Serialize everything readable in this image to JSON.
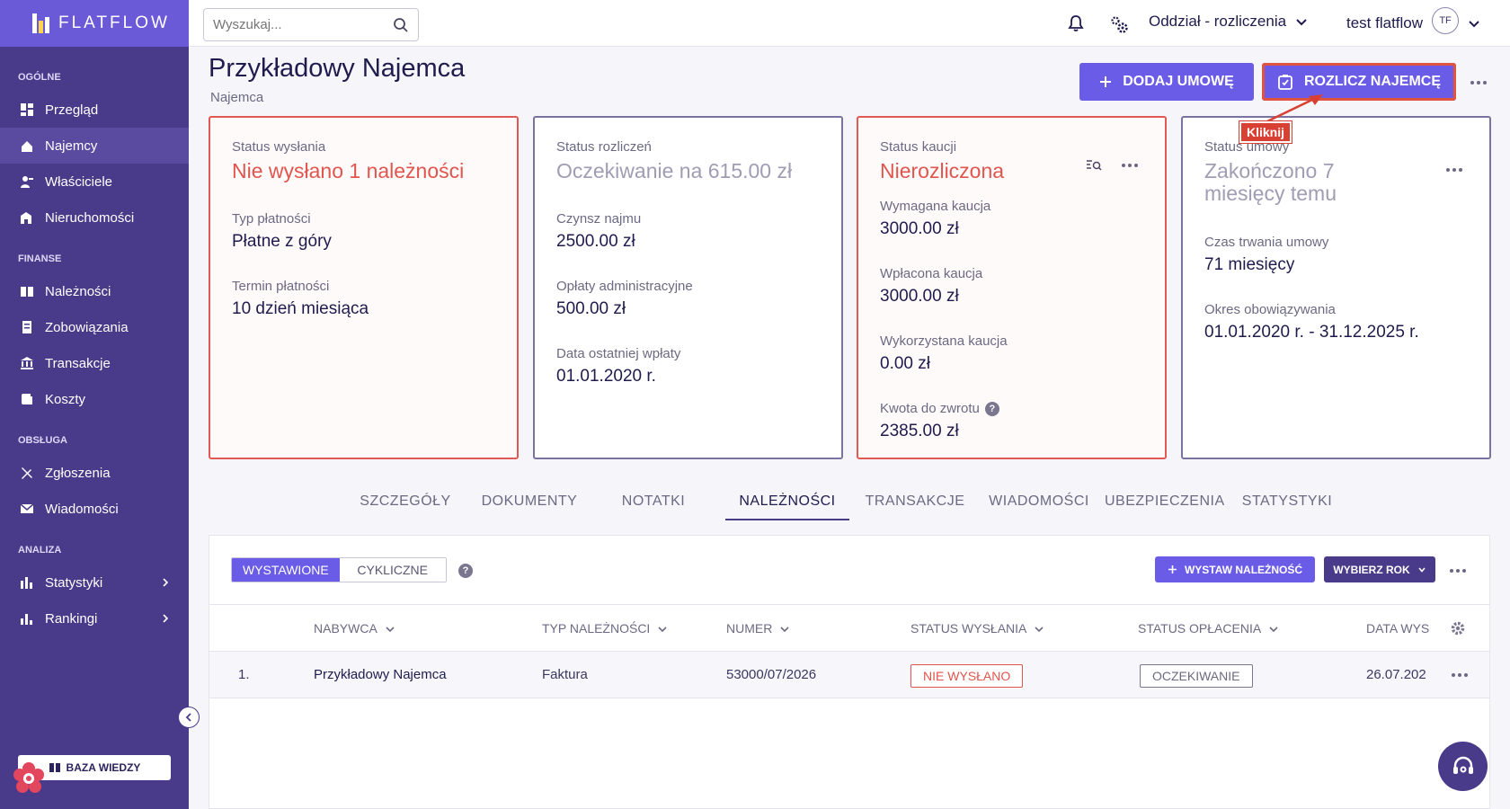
{
  "app": {
    "brand": "FLATFLOW"
  },
  "sidebar": {
    "sections": [
      "OGÓLNE",
      "FINANSE",
      "OBSŁUGA",
      "ANALIZA"
    ],
    "items": [
      {
        "label": "Przegląd"
      },
      {
        "label": "Najemcy",
        "active": true
      },
      {
        "label": "Właściciele"
      },
      {
        "label": "Nieruchomości"
      },
      {
        "label": "Należności"
      },
      {
        "label": "Zobowiązania"
      },
      {
        "label": "Transakcje"
      },
      {
        "label": "Koszty"
      },
      {
        "label": "Zgłoszenia"
      },
      {
        "label": "Wiadomości"
      },
      {
        "label": "Statystyki"
      },
      {
        "label": "Rankingi"
      }
    ],
    "knowledge_base": "BAZA WIEDZY"
  },
  "topbar": {
    "search_placeholder": "Wyszukaj...",
    "branch": "Oddział - rozliczenia",
    "user": "test flatflow",
    "avatar": "TF"
  },
  "page": {
    "title": "Przykładowy Najemca",
    "subtitle": "Najemca",
    "add_contract": "DODAJ UMOWĘ",
    "settle_tenant": "ROZLICZ NAJEMCĘ",
    "callout": "Kliknij"
  },
  "cards": {
    "sending": {
      "label": "Status wysłania",
      "status": "Nie wysłano 1 należności",
      "f1_label": "Typ płatności",
      "f1_value": "Płatne z góry",
      "f2_label": "Termin płatności",
      "f2_value": "10 dzień miesiąca"
    },
    "settlement": {
      "label": "Status rozliczeń",
      "status": "Oczekiwanie na 615.00 zł",
      "f1_label": "Czynsz najmu",
      "f1_value": "2500.00 zł",
      "f2_label": "Opłaty administracyjne",
      "f2_value": "500.00 zł",
      "f3_label": "Data ostatniej wpłaty",
      "f3_value": "01.01.2020 r."
    },
    "deposit": {
      "label": "Status kaucji",
      "status": "Nierozliczona",
      "f1_label": "Wymagana kaucja",
      "f1_value": "3000.00 zł",
      "f2_label": "Wpłacona kaucja",
      "f2_value": "3000.00 zł",
      "f3_label": "Wykorzystana kaucja",
      "f3_value": "0.00 zł",
      "f4_label": "Kwota do zwrotu",
      "f4_value": "2385.00 zł"
    },
    "contract": {
      "label": "Status umowy",
      "status": "Zakończono 7 miesięcy temu",
      "f1_label": "Czas trwania umowy",
      "f1_value": "71 miesięcy",
      "f2_label": "Okres obowiązywania",
      "f2_value": "01.01.2020 r. - 31.12.2025 r."
    }
  },
  "tabs": [
    {
      "label": "SZCZEGÓŁY"
    },
    {
      "label": "DOKUMENTY"
    },
    {
      "label": "NOTATKI"
    },
    {
      "label": "NALEŻNOŚCI",
      "active": true
    },
    {
      "label": "TRANSAKCJE"
    },
    {
      "label": "WIADOMOŚCI"
    },
    {
      "label": "UBEZPIECZENIA"
    },
    {
      "label": "STATYSTYKI"
    }
  ],
  "receivables": {
    "toggle": {
      "issued": "WYSTAWIONE",
      "cyclic": "CYKLICZNE"
    },
    "issue_button": "WYSTAW NALEŻNOŚĆ",
    "year_button": "WYBIERZ ROK",
    "columns": [
      "NABYWCA",
      "TYP NALEŻNOŚCI",
      "NUMER",
      "STATUS WYSŁANIA",
      "STATUS OPŁACENIA",
      "DATA WYS"
    ],
    "rows": [
      {
        "index": "1.",
        "buyer": "Przykładowy Najemca",
        "type": "Faktura",
        "number": "53000/07/2026",
        "send_status": "NIE WYSŁANO",
        "pay_status": "OCZEKIWANIE",
        "date": "26.07.202"
      }
    ]
  },
  "colors": {
    "sidebar": "#4a3a8a",
    "accent": "#6b5ce7",
    "danger": "#e0554d"
  }
}
